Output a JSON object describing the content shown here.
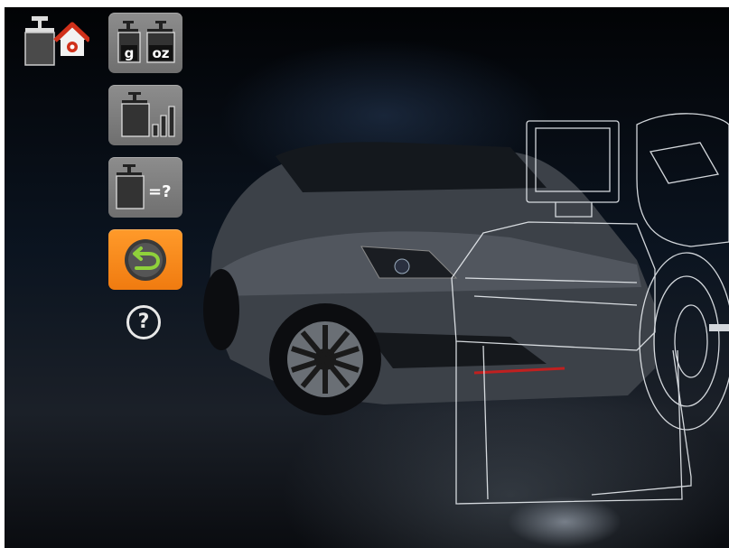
{
  "sidebar": {
    "home_icon": "weight-home-icon",
    "units_button": {
      "gram_label": "g",
      "ounce_label": "oz",
      "icon": "weight-units-icon"
    },
    "stats_button": {
      "icon": "weight-statistics-icon"
    },
    "weigh_button": {
      "label": "=?",
      "icon": "weight-query-icon"
    },
    "back_button": {
      "icon": "back-arrow-icon"
    },
    "help_button": {
      "label": "?",
      "icon": "help-icon"
    }
  },
  "colors": {
    "button_gray": "#808080",
    "button_accent": "#f5841b",
    "back_circle_green": "#7fb832",
    "home_red": "#d0301a"
  },
  "background": {
    "subject": "car-and-wheel-balancer-illustration"
  }
}
